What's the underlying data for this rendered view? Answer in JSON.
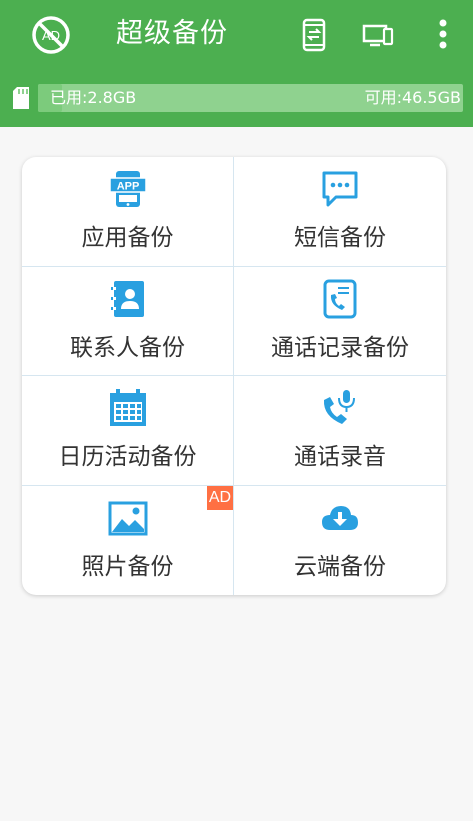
{
  "app": {
    "title": "超级备份",
    "ad_icon_text": "AD"
  },
  "storage": {
    "used": "已用:2.8GB",
    "free": "可用:46.5GB",
    "used_fraction": 0.057
  },
  "grid": {
    "items": [
      {
        "label": "应用备份",
        "icon": "app-icon",
        "icon_text": "APP"
      },
      {
        "label": "短信备份",
        "icon": "sms-icon"
      },
      {
        "label": "联系人备份",
        "icon": "contacts-icon"
      },
      {
        "label": "通话记录备份",
        "icon": "call-log-icon"
      },
      {
        "label": "日历活动备份",
        "icon": "calendar-icon"
      },
      {
        "label": "通话录音",
        "icon": "call-recording-icon"
      },
      {
        "label": "照片备份",
        "icon": "photo-icon",
        "badge": "AD"
      },
      {
        "label": "云端备份",
        "icon": "cloud-download-icon"
      }
    ]
  },
  "colors": {
    "header": "#4caf50",
    "accent_blue": "#29a0e0",
    "ad_badge": "#ff7043"
  }
}
